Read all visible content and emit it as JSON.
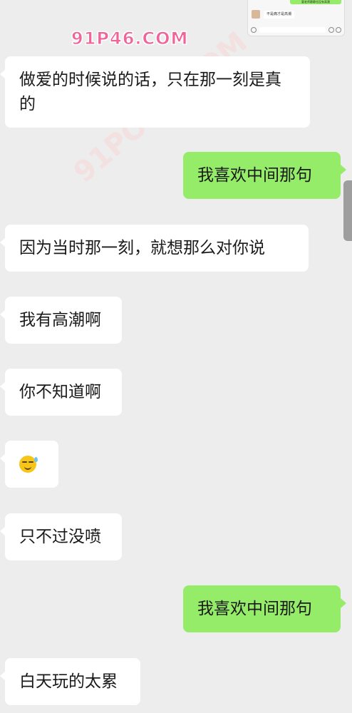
{
  "watermark": {
    "logo_text": "91P46.COM",
    "diagonal_text": "91PORN.COM"
  },
  "float_window": {
    "top_message": "要老师静静也没有高潮",
    "message": "不是痛才是高潮"
  },
  "messages": [
    {
      "side": "in",
      "text": "做爱的时候说的话，只在那一刻是真的"
    },
    {
      "side": "out",
      "text": "我喜欢中间那句"
    },
    {
      "side": "in",
      "text": "因为当时那一刻，就想那么对你说"
    },
    {
      "side": "in",
      "text": "我有高潮啊"
    },
    {
      "side": "in",
      "text": "你不知道啊"
    },
    {
      "side": "in",
      "emoji": "sweat-smile-emoji"
    },
    {
      "side": "in",
      "text": "只不过没喷"
    },
    {
      "side": "out",
      "text": "我喜欢中间那句"
    },
    {
      "side": "in",
      "text": "白天玩的太累"
    }
  ],
  "colors": {
    "background": "#ededed",
    "incoming_bubble": "#ffffff",
    "outgoing_bubble": "#95ec69",
    "text": "#1a1a1a"
  }
}
